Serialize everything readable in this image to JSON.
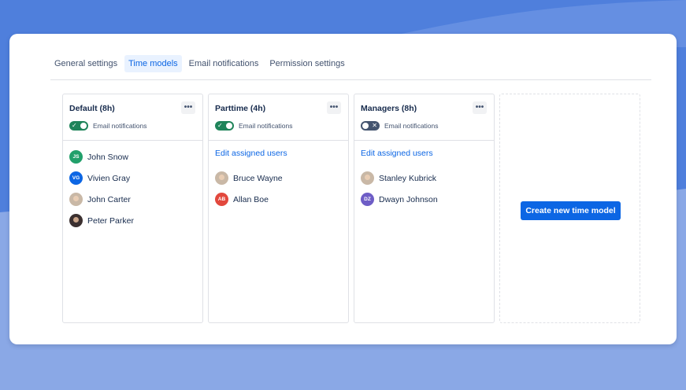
{
  "colors": {
    "background_top": "#4f7fdc",
    "background_bottom": "#8aa8e6",
    "accent": "#0c66e4",
    "toggle_on": "#1f845a",
    "toggle_off": "#44546f"
  },
  "tabs": [
    {
      "label": "General settings",
      "active": false
    },
    {
      "label": "Time models",
      "active": true
    },
    {
      "label": "Email notifications",
      "active": false
    },
    {
      "label": "Permission settings",
      "active": false
    }
  ],
  "models": [
    {
      "title": "Default (8h)",
      "menu_icon": "more-horizontal-icon",
      "email_notifications": {
        "label": "Email notifications",
        "enabled": true
      },
      "edit_link": "",
      "users": [
        {
          "name": "John Snow",
          "initials": "JS",
          "avatar_color": "#22a06b",
          "photo": false
        },
        {
          "name": "Vivien Gray",
          "initials": "VG",
          "avatar_color": "#0c66e4",
          "photo": false
        },
        {
          "name": "John Carter",
          "initials": "",
          "avatar_color": "",
          "photo": true
        },
        {
          "name": "Peter Parker",
          "initials": "",
          "avatar_color": "",
          "photo": true
        }
      ]
    },
    {
      "title": "Parttime (4h)",
      "menu_icon": "more-horizontal-icon",
      "email_notifications": {
        "label": "Email notifications",
        "enabled": true
      },
      "edit_link": "Edit assigned users",
      "users": [
        {
          "name": "Bruce Wayne",
          "initials": "",
          "avatar_color": "",
          "photo": true
        },
        {
          "name": "Allan Boe",
          "initials": "AB",
          "avatar_color": "#e2483d",
          "photo": false
        }
      ]
    },
    {
      "title": "Managers (8h)",
      "menu_icon": "more-horizontal-icon",
      "email_notifications": {
        "label": "Email notifications",
        "enabled": false
      },
      "edit_link": "Edit assigned users",
      "users": [
        {
          "name": "Stanley Kubrick",
          "initials": "",
          "avatar_color": "",
          "photo": true
        },
        {
          "name": "Dwayn Johnson",
          "initials": "DZ",
          "avatar_color": "#6e5dc6",
          "photo": false
        }
      ]
    }
  ],
  "create_button": {
    "label": "Create new time model"
  }
}
